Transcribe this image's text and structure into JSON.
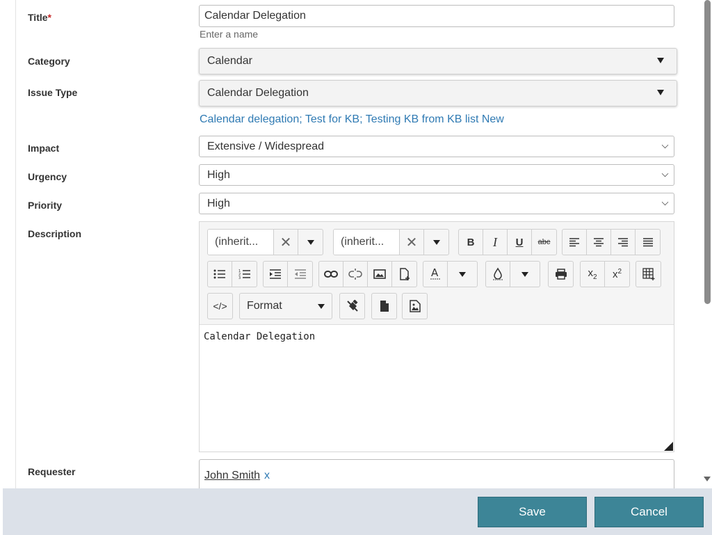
{
  "form": {
    "title": {
      "label": "Title",
      "required_mark": "*",
      "value": "Calendar Delegation",
      "hint": "Enter a name"
    },
    "category": {
      "label": "Category",
      "value": "Calendar"
    },
    "issue_type": {
      "label": "Issue Type",
      "value": "Calendar Delegation"
    },
    "kb_links": [
      "Calendar delegation",
      "Test for KB",
      "Testing KB from KB list New"
    ],
    "kb_separator": "; ",
    "impact": {
      "label": "Impact",
      "value": "Extensive / Widespread"
    },
    "urgency": {
      "label": "Urgency",
      "value": "High"
    },
    "priority": {
      "label": "Priority",
      "value": "High"
    },
    "description": {
      "label": "Description",
      "font_family_value": "(inherit...",
      "font_size_value": "(inherit...",
      "format_label": "Format",
      "content": "Calendar Delegation"
    },
    "requester": {
      "label": "Requester",
      "name": "John Smith",
      "remove": "x"
    }
  },
  "footer": {
    "save_label": "Save",
    "cancel_label": "Cancel"
  },
  "icons": [
    "close-icon",
    "chevron-down-icon",
    "bold-icon",
    "italic-icon",
    "underline-icon",
    "strikethrough-icon",
    "align-left-icon",
    "align-center-icon",
    "align-right-icon",
    "justify-icon",
    "bullet-list-icon",
    "numbered-list-icon",
    "indent-icon",
    "outdent-icon",
    "link-icon",
    "unlink-icon",
    "image-icon",
    "insert-file-icon",
    "font-color-icon",
    "background-color-icon",
    "print-icon",
    "subscript-icon",
    "superscript-icon",
    "table-icon",
    "code-view-icon",
    "clear-formatting-icon",
    "pdf-export-icon",
    "image-browser-icon"
  ],
  "colors": {
    "link": "#2f7ab3",
    "required": "#c62828",
    "button": "#3d8597",
    "footer": "#dce1e9"
  }
}
